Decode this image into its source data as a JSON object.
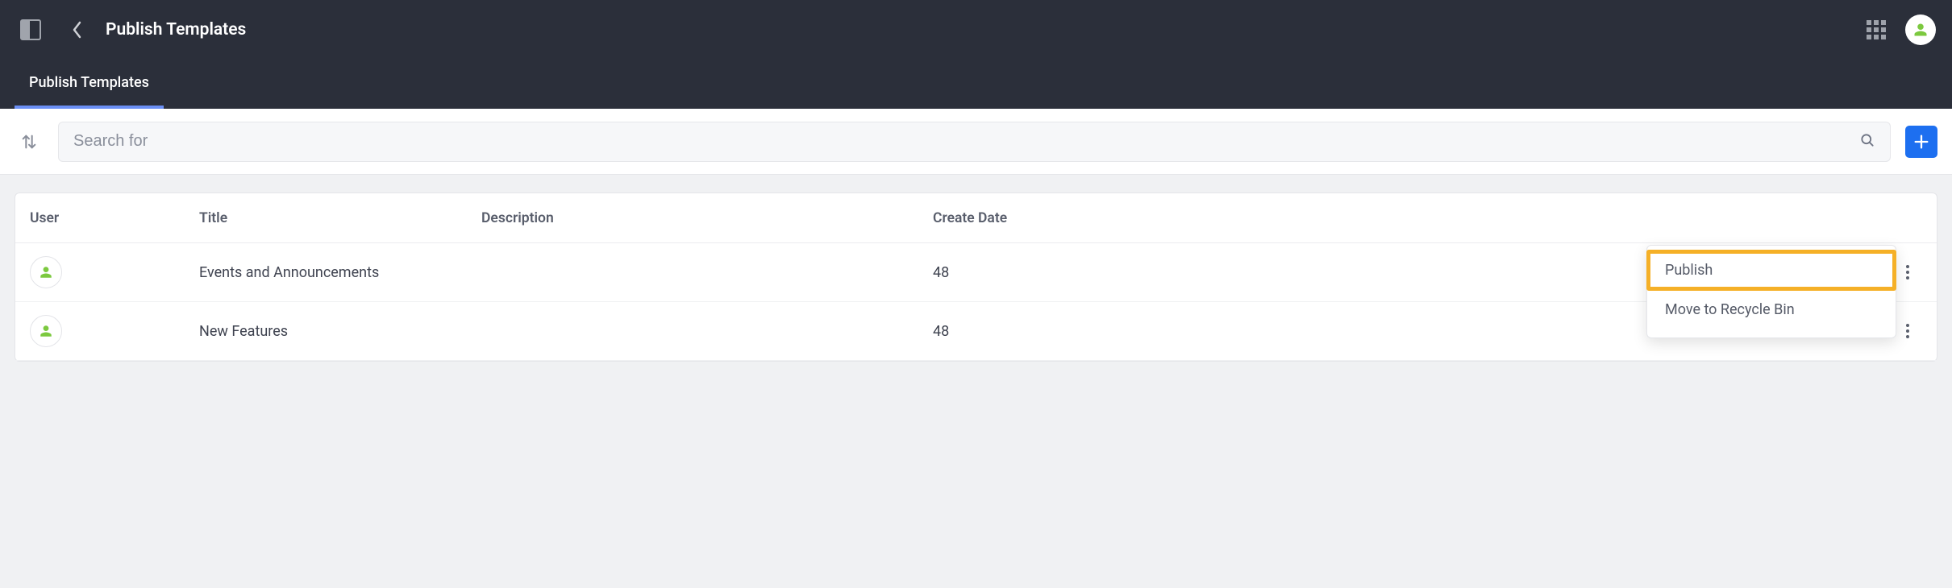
{
  "header": {
    "title": "Publish Templates"
  },
  "tabs": {
    "active": "Publish Templates"
  },
  "search": {
    "placeholder": "Search for"
  },
  "table": {
    "columns": {
      "user": "User",
      "title": "Title",
      "description": "Description",
      "create_date": "Create Date"
    },
    "rows": [
      {
        "title": "Events and Announcements",
        "description": "",
        "create_date": "48"
      },
      {
        "title": "New Features",
        "description": "",
        "create_date": "48"
      }
    ]
  },
  "menu": {
    "publish": "Publish",
    "recycle": "Move to Recycle Bin"
  }
}
